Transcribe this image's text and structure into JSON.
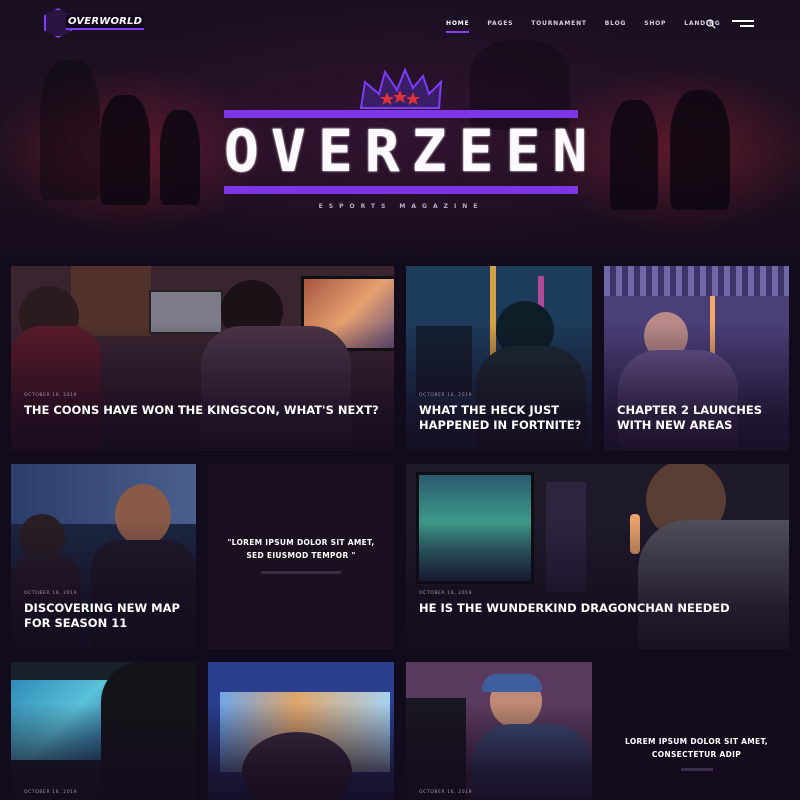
{
  "logo": {
    "text": "OVERWORLD"
  },
  "nav": {
    "items": [
      {
        "label": "HOME",
        "active": true
      },
      {
        "label": "PAGES",
        "active": false
      },
      {
        "label": "TOURNAMENT",
        "active": false
      },
      {
        "label": "BLOG",
        "active": false
      },
      {
        "label": "SHOP",
        "active": false
      },
      {
        "label": "LANDING",
        "active": false
      }
    ],
    "icons": [
      "search-icon",
      "menu-icon"
    ]
  },
  "hero": {
    "title": "OVERZEEN",
    "subtitle": "ESPORTS MAGAZINE",
    "accent": "#7e35e8",
    "star_color": "#e0303a"
  },
  "posts": [
    {
      "date": "OCTOBER 16, 2019",
      "title": "THE COONS HAVE WON THE KINGSCON, WHAT'S NEXT?"
    },
    {
      "date": "OCTOBER 16, 2019",
      "title": "WHAT THE HECK JUST HAPPENED IN FORTNITE?"
    },
    {
      "date": "",
      "title": "CHAPTER 2 LAUNCHES WITH NEW AREAS"
    },
    {
      "date": "OCTOBER 16, 2019",
      "title": "DISCOVERING NEW MAP FOR SEASON 11"
    },
    {
      "date": "OCTOBER 16, 2019",
      "title": "HE IS THE WUNDERKIND DRAGONCHAN NEEDED"
    },
    {
      "date": "OCTOBER 16, 2019",
      "title": ""
    },
    {
      "date": "",
      "title": ""
    },
    {
      "date": "OCTOBER 16, 2019",
      "title": ""
    }
  ],
  "quotes": [
    {
      "line1": "\"LOREM IPSUM DOLOR SIT AMET,",
      "line2": "SED EIUSMOD TEMPOR \"",
      "meta": ""
    },
    {
      "line1": "LOREM IPSUM DOLOR SIT AMET,",
      "line2": "CONSECTETUR ADIP",
      "meta": ""
    }
  ]
}
